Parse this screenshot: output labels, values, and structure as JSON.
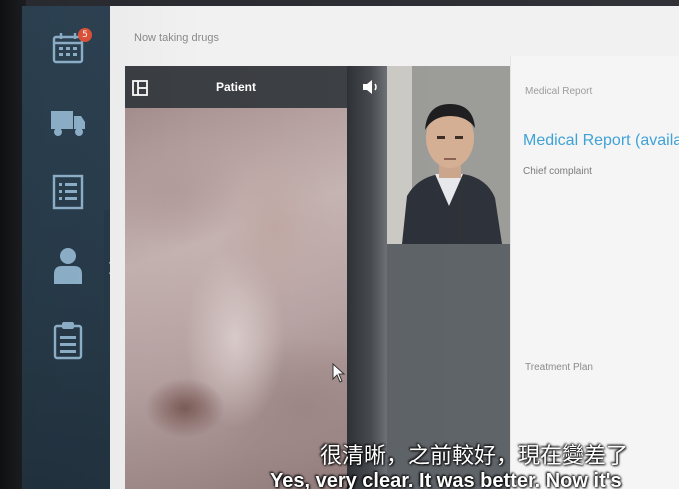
{
  "sidebar": {
    "badge_count": "5",
    "items": [
      {
        "icon": "calendar-icon"
      },
      {
        "icon": "truck-icon"
      },
      {
        "icon": "list-icon"
      },
      {
        "icon": "user-icon"
      },
      {
        "icon": "clipboard-icon"
      }
    ]
  },
  "main": {
    "drug_status": "Now taking drugs"
  },
  "video": {
    "title": "Patient"
  },
  "report": {
    "section_label": "Medical Report",
    "title": "Medical Report (availa",
    "chief_complaint_label": "Chief complaint",
    "treatment_plan_label": "Treatment Plan"
  },
  "subtitles": {
    "chinese": "很清晰，之前較好，現在變差了",
    "english": "Yes, very clear. It was better. Now it's"
  },
  "colors": {
    "sidebar": "#2d4253",
    "accent": "#3aa0d6",
    "badge": "#e0533a"
  }
}
